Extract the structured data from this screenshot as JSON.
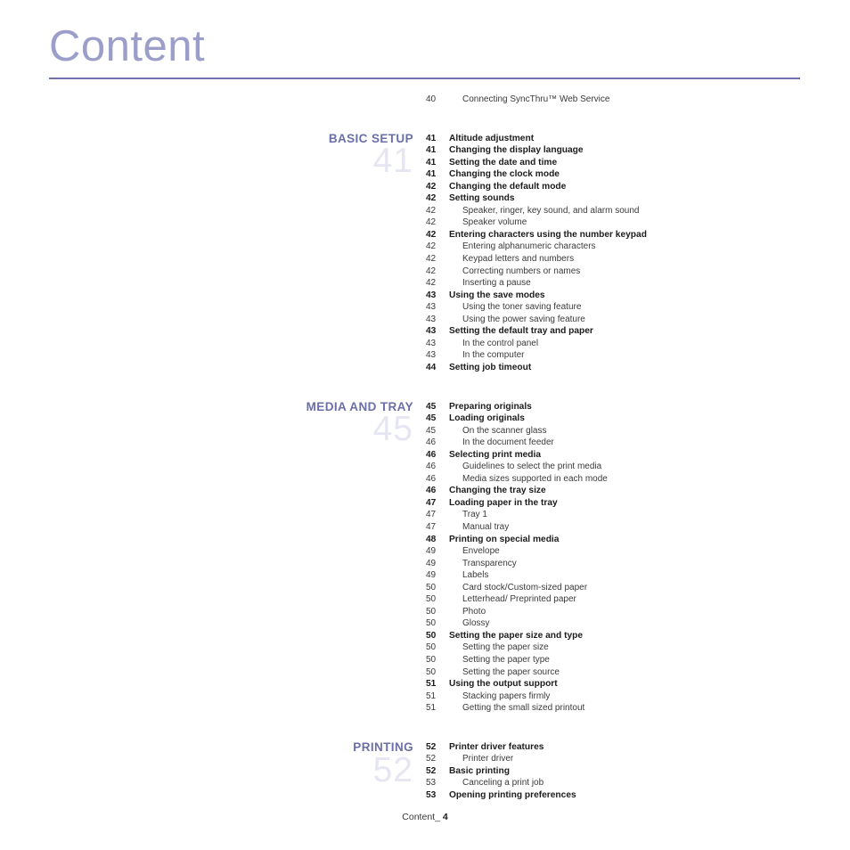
{
  "header": {
    "title": "Content",
    "rule_color": "#6f72a8",
    "title_color": "#9b9ec9"
  },
  "footer": {
    "label": "Content_",
    "page_number": "4"
  },
  "toc": {
    "accent_color": "#6b6fa8",
    "watermark_color": "#e6e6f2",
    "orphan_entries": [
      {
        "num": "40",
        "label": "Connecting SyncThru™ Web Service",
        "level": 2
      }
    ],
    "sections": [
      {
        "label": "BASIC SETUP",
        "watermark": "41",
        "entries": [
          {
            "num": "41",
            "label": "Altitude adjustment",
            "level": 1
          },
          {
            "num": "41",
            "label": "Changing the display language",
            "level": 1
          },
          {
            "num": "41",
            "label": "Setting the date and time",
            "level": 1
          },
          {
            "num": "41",
            "label": "Changing the clock mode",
            "level": 1
          },
          {
            "num": "42",
            "label": "Changing the default mode",
            "level": 1
          },
          {
            "num": "42",
            "label": "Setting sounds",
            "level": 1
          },
          {
            "num": "42",
            "label": "Speaker, ringer, key sound, and alarm sound",
            "level": 2
          },
          {
            "num": "42",
            "label": "Speaker volume",
            "level": 2
          },
          {
            "num": "42",
            "label": "Entering characters using the number keypad",
            "level": 1
          },
          {
            "num": "42",
            "label": "Entering alphanumeric characters",
            "level": 2
          },
          {
            "num": "42",
            "label": "Keypad letters and numbers",
            "level": 2
          },
          {
            "num": "42",
            "label": "Correcting numbers or names",
            "level": 2
          },
          {
            "num": "42",
            "label": "Inserting a pause",
            "level": 2
          },
          {
            "num": "43",
            "label": "Using the save modes",
            "level": 1
          },
          {
            "num": "43",
            "label": "Using the toner saving feature",
            "level": 2
          },
          {
            "num": "43",
            "label": "Using the power saving feature",
            "level": 2
          },
          {
            "num": "43",
            "label": "Setting the default tray and paper",
            "level": 1
          },
          {
            "num": "43",
            "label": "In the control panel",
            "level": 2
          },
          {
            "num": "43",
            "label": "In the computer",
            "level": 2
          },
          {
            "num": "44",
            "label": "Setting job timeout",
            "level": 1
          }
        ]
      },
      {
        "label": "MEDIA AND TRAY",
        "watermark": "45",
        "entries": [
          {
            "num": "45",
            "label": "Preparing originals",
            "level": 1
          },
          {
            "num": "45",
            "label": "Loading originals",
            "level": 1
          },
          {
            "num": "45",
            "label": "On the scanner glass",
            "level": 2
          },
          {
            "num": "46",
            "label": "In the document feeder",
            "level": 2
          },
          {
            "num": "46",
            "label": "Selecting print media",
            "level": 1
          },
          {
            "num": "46",
            "label": "Guidelines to select the print media",
            "level": 2
          },
          {
            "num": "46",
            "label": "Media sizes supported in each mode",
            "level": 2
          },
          {
            "num": "46",
            "label": "Changing the tray size",
            "level": 1
          },
          {
            "num": "47",
            "label": "Loading paper in the tray",
            "level": 1
          },
          {
            "num": "47",
            "label": "Tray 1",
            "level": 2
          },
          {
            "num": "47",
            "label": "Manual tray",
            "level": 2
          },
          {
            "num": "48",
            "label": "Printing on special media",
            "level": 1
          },
          {
            "num": "49",
            "label": "Envelope",
            "level": 2
          },
          {
            "num": "49",
            "label": "Transparency",
            "level": 2
          },
          {
            "num": "49",
            "label": "Labels",
            "level": 2
          },
          {
            "num": "50",
            "label": "Card stock/Custom-sized paper",
            "level": 2
          },
          {
            "num": "50",
            "label": "Letterhead/ Preprinted paper",
            "level": 2
          },
          {
            "num": "50",
            "label": "Photo",
            "level": 2
          },
          {
            "num": "50",
            "label": "Glossy",
            "level": 2
          },
          {
            "num": "50",
            "label": "Setting the paper size and type",
            "level": 1
          },
          {
            "num": "50",
            "label": "Setting the paper size",
            "level": 2
          },
          {
            "num": "50",
            "label": "Setting the paper type",
            "level": 2
          },
          {
            "num": "50",
            "label": "Setting the paper source",
            "level": 2
          },
          {
            "num": "51",
            "label": "Using the output support",
            "level": 1
          },
          {
            "num": "51",
            "label": "Stacking papers firmly",
            "level": 2
          },
          {
            "num": "51",
            "label": "Getting the small sized printout",
            "level": 2
          }
        ]
      },
      {
        "label": "PRINTING",
        "watermark": "52",
        "entries": [
          {
            "num": "52",
            "label": "Printer driver features",
            "level": 1
          },
          {
            "num": "52",
            "label": "Printer driver",
            "level": 2
          },
          {
            "num": "52",
            "label": "Basic printing",
            "level": 1
          },
          {
            "num": "53",
            "label": "Canceling a print job",
            "level": 2
          },
          {
            "num": "53",
            "label": "Opening printing preferences",
            "level": 1
          }
        ]
      }
    ]
  }
}
